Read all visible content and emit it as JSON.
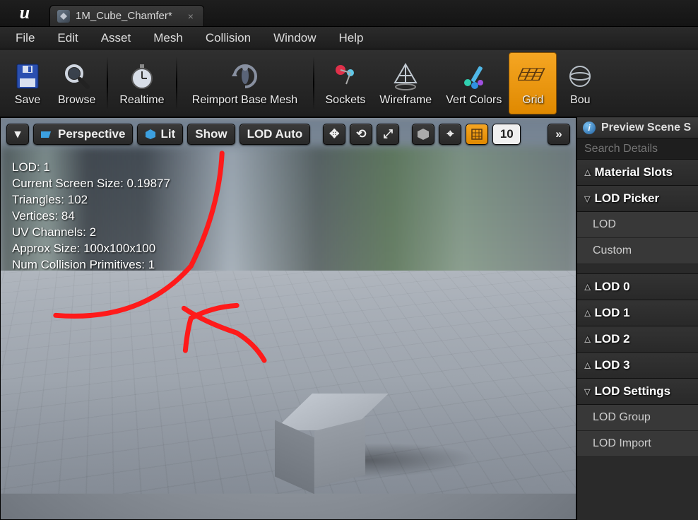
{
  "titlebar": {
    "tab_title": "1M_Cube_Chamfer*"
  },
  "menubar": [
    "File",
    "Edit",
    "Asset",
    "Mesh",
    "Collision",
    "Window",
    "Help"
  ],
  "toolbar": [
    {
      "label": "Save",
      "icon": "save-icon"
    },
    {
      "label": "Browse",
      "icon": "magnifier-icon"
    },
    {
      "label": "Realtime",
      "icon": "stopwatch-icon"
    },
    {
      "label": "Reimport Base Mesh",
      "icon": "reimport-icon"
    },
    {
      "label": "Sockets",
      "icon": "sockets-icon"
    },
    {
      "label": "Wireframe",
      "icon": "wireframe-icon"
    },
    {
      "label": "Vert Colors",
      "icon": "vertcolors-icon"
    },
    {
      "label": "Grid",
      "icon": "grid-icon",
      "active": true
    },
    {
      "label": "Bou",
      "icon": "bounds-icon"
    }
  ],
  "viewport_controls": {
    "dropdown_triangle": "▾",
    "perspective": "Perspective",
    "lit": "Lit",
    "show": "Show",
    "lod_auto": "LOD Auto",
    "snap_value": "10",
    "expand": "»"
  },
  "viewport_stats": {
    "lod": "LOD:  1",
    "screen_size": "Current Screen Size:  0.19877",
    "triangles": "Triangles:  102",
    "vertices": "Vertices:  84",
    "uv_channels": "UV Channels:  2",
    "approx_size": "Approx Size: 100x100x100",
    "collision_prims": "Num Collision Primitives:  1"
  },
  "details": {
    "panel_title": "Preview Scene S",
    "search_placeholder": "Search Details",
    "sections": [
      {
        "title": "Material Slots",
        "expanded": false,
        "items": []
      },
      {
        "title": "LOD Picker",
        "expanded": true,
        "items": [
          "LOD",
          "Custom"
        ]
      },
      {
        "title": "LOD 0",
        "expanded": false,
        "items": []
      },
      {
        "title": "LOD 1",
        "expanded": false,
        "items": []
      },
      {
        "title": "LOD 2",
        "expanded": false,
        "items": []
      },
      {
        "title": "LOD 3",
        "expanded": false,
        "items": []
      },
      {
        "title": "LOD Settings",
        "expanded": true,
        "items": [
          "LOD Group",
          "LOD Import"
        ]
      }
    ]
  },
  "colors": {
    "accent_orange": "#f5a623",
    "annotation_red": "#ff1a1a"
  }
}
